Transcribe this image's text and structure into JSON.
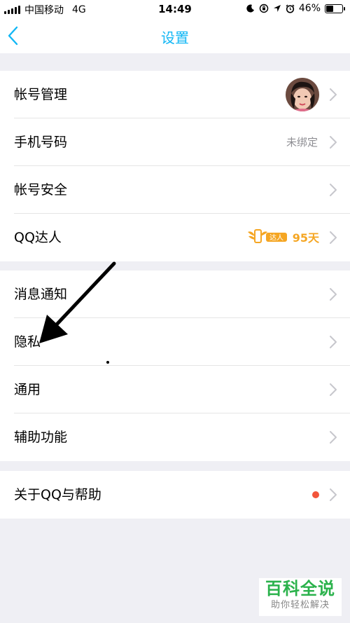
{
  "status_bar": {
    "carrier": "中国移动",
    "network": "4G",
    "time": "14:49",
    "battery_percent": "46%",
    "battery_level": 0.46,
    "icons": [
      "moon-icon",
      "rotation-lock-icon",
      "location-icon",
      "alarm-icon",
      "battery-icon"
    ]
  },
  "nav": {
    "back_icon": "chevron-left-icon",
    "title": "设置"
  },
  "groups": [
    {
      "items": [
        {
          "label": "帐号管理",
          "accessory": "avatar"
        },
        {
          "label": "手机号码",
          "value": "未绑定"
        },
        {
          "label": "帐号安全"
        },
        {
          "label": "QQ达人",
          "badge_text": "达人",
          "badge_days": "95天"
        }
      ]
    },
    {
      "items": [
        {
          "label": "消息通知"
        },
        {
          "label": "隐私"
        },
        {
          "label": "通用"
        },
        {
          "label": "辅助功能"
        }
      ]
    },
    {
      "items": [
        {
          "label": "关于QQ与帮助",
          "accessory": "red-dot"
        }
      ]
    }
  ],
  "colors": {
    "accent": "#12b7f5",
    "background": "#efeff4",
    "badge_gold": "#f5a623",
    "red_dot": "#f2553b",
    "watermark_green": "#2bb24c"
  },
  "watermark": {
    "title": "百科全说",
    "subtitle": "助你轻松解决"
  }
}
